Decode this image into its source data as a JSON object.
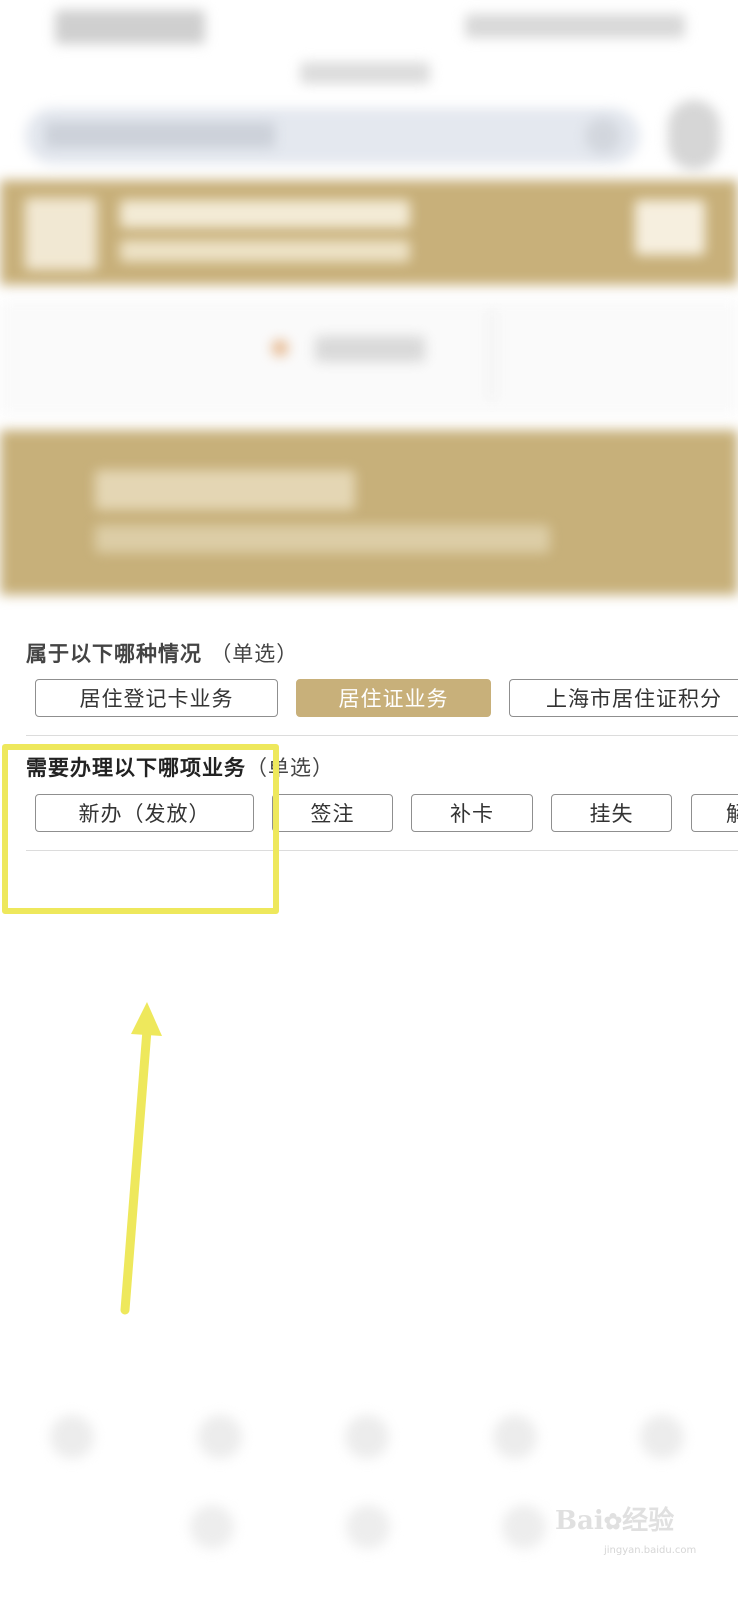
{
  "question1": {
    "title": "属于以下哪种情况",
    "hint": "（单选）",
    "options": [
      "居住登记卡业务",
      "居住证业务",
      "上海市居住证积分"
    ],
    "selected_index": 1
  },
  "question2": {
    "title": "需要办理以下哪项业务",
    "hint": "（单选）",
    "options": [
      "新办（发放）",
      "签注",
      "补卡",
      "挂失",
      "解"
    ]
  },
  "colors": {
    "accent_gold": "#c8b07a",
    "highlight_yellow": "#eee85c",
    "border_gray": "#8f8f8f"
  },
  "watermark": {
    "brand": "Bai",
    "brand2": "经验",
    "url": "jingyan.baidu.com"
  }
}
